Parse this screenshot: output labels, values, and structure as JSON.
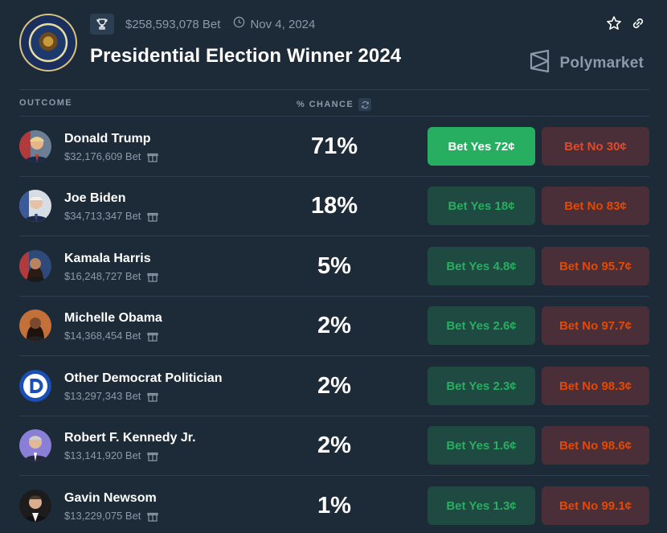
{
  "header": {
    "volume": "$258,593,078 Bet",
    "date": "Nov 4, 2024",
    "title": "Presidential Election Winner 2024",
    "brand": "Polymarket",
    "icons": [
      "trophy-icon",
      "clock-icon",
      "star-icon",
      "link-icon",
      "polymarket-logo-icon"
    ]
  },
  "columns": {
    "outcome": "OUTCOME",
    "chance": "% CHANCE"
  },
  "colors": {
    "background": "#1d2b39",
    "yes_active": "#27ae60",
    "yes_bg": "#1f4a42",
    "no_bg": "#4a2f39",
    "no_text": "#e64800",
    "muted_text": "#8a9aab"
  },
  "outcomes": [
    {
      "name": "Donald Trump",
      "volume": "$32,176,609 Bet",
      "chance": "71%",
      "yes": "Bet Yes 72¢",
      "no": "Bet No 30¢"
    },
    {
      "name": "Joe Biden",
      "volume": "$34,713,347 Bet",
      "chance": "18%",
      "yes": "Bet Yes 18¢",
      "no": "Bet No 83¢"
    },
    {
      "name": "Kamala Harris",
      "volume": "$16,248,727 Bet",
      "chance": "5%",
      "yes": "Bet Yes 4.8¢",
      "no": "Bet No 95.7¢"
    },
    {
      "name": "Michelle Obama",
      "volume": "$14,368,454 Bet",
      "chance": "2%",
      "yes": "Bet Yes 2.6¢",
      "no": "Bet No 97.7¢"
    },
    {
      "name": "Other Democrat Politician",
      "volume": "$13,297,343 Bet",
      "chance": "2%",
      "yes": "Bet Yes 2.3¢",
      "no": "Bet No 98.3¢"
    },
    {
      "name": "Robert F. Kennedy Jr.",
      "volume": "$13,141,920 Bet",
      "chance": "2%",
      "yes": "Bet Yes 1.6¢",
      "no": "Bet No 98.6¢"
    },
    {
      "name": "Gavin Newsom",
      "volume": "$13,229,075 Bet",
      "chance": "1%",
      "yes": "Bet Yes 1.3¢",
      "no": "Bet No 99.1¢"
    }
  ]
}
